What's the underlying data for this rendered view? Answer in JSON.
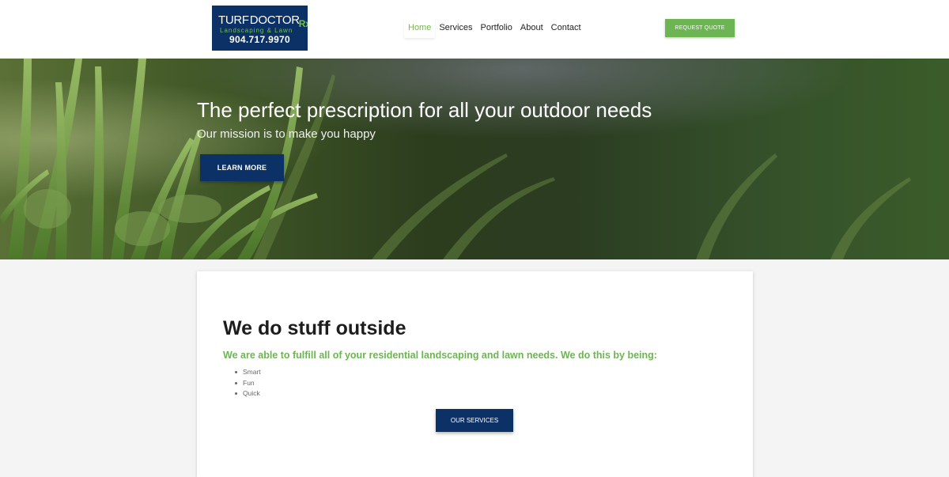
{
  "header": {
    "logo": {
      "brand_part1": "TURF",
      "brand_part2": "DOCTOR",
      "brand_suffix": "Rx",
      "tagline": "Landscaping & Lawn",
      "phone": "904.717.9970"
    },
    "nav": [
      {
        "label": "Home",
        "active": true
      },
      {
        "label": "Services",
        "active": false
      },
      {
        "label": "Portfolio",
        "active": false
      },
      {
        "label": "About",
        "active": false
      },
      {
        "label": "Contact",
        "active": false
      }
    ],
    "cta_label": "REQUEST QUOTE"
  },
  "hero": {
    "title": "The perfect prescription for all your outdoor needs",
    "subtitle": "Our mission is to make you happy",
    "button_label": "LEARN MORE"
  },
  "intro": {
    "title": "We do stuff outside",
    "lead": "We are able to fulfill all of your residential landscaping and lawn needs. We do this by being:",
    "qualities": [
      "Smart",
      "Fun",
      "Quick"
    ],
    "button_label": "OUR SERVICES"
  },
  "colors": {
    "brand_navy": "#0b3166",
    "brand_green": "#6db552",
    "nav_active": "#76b84a"
  }
}
